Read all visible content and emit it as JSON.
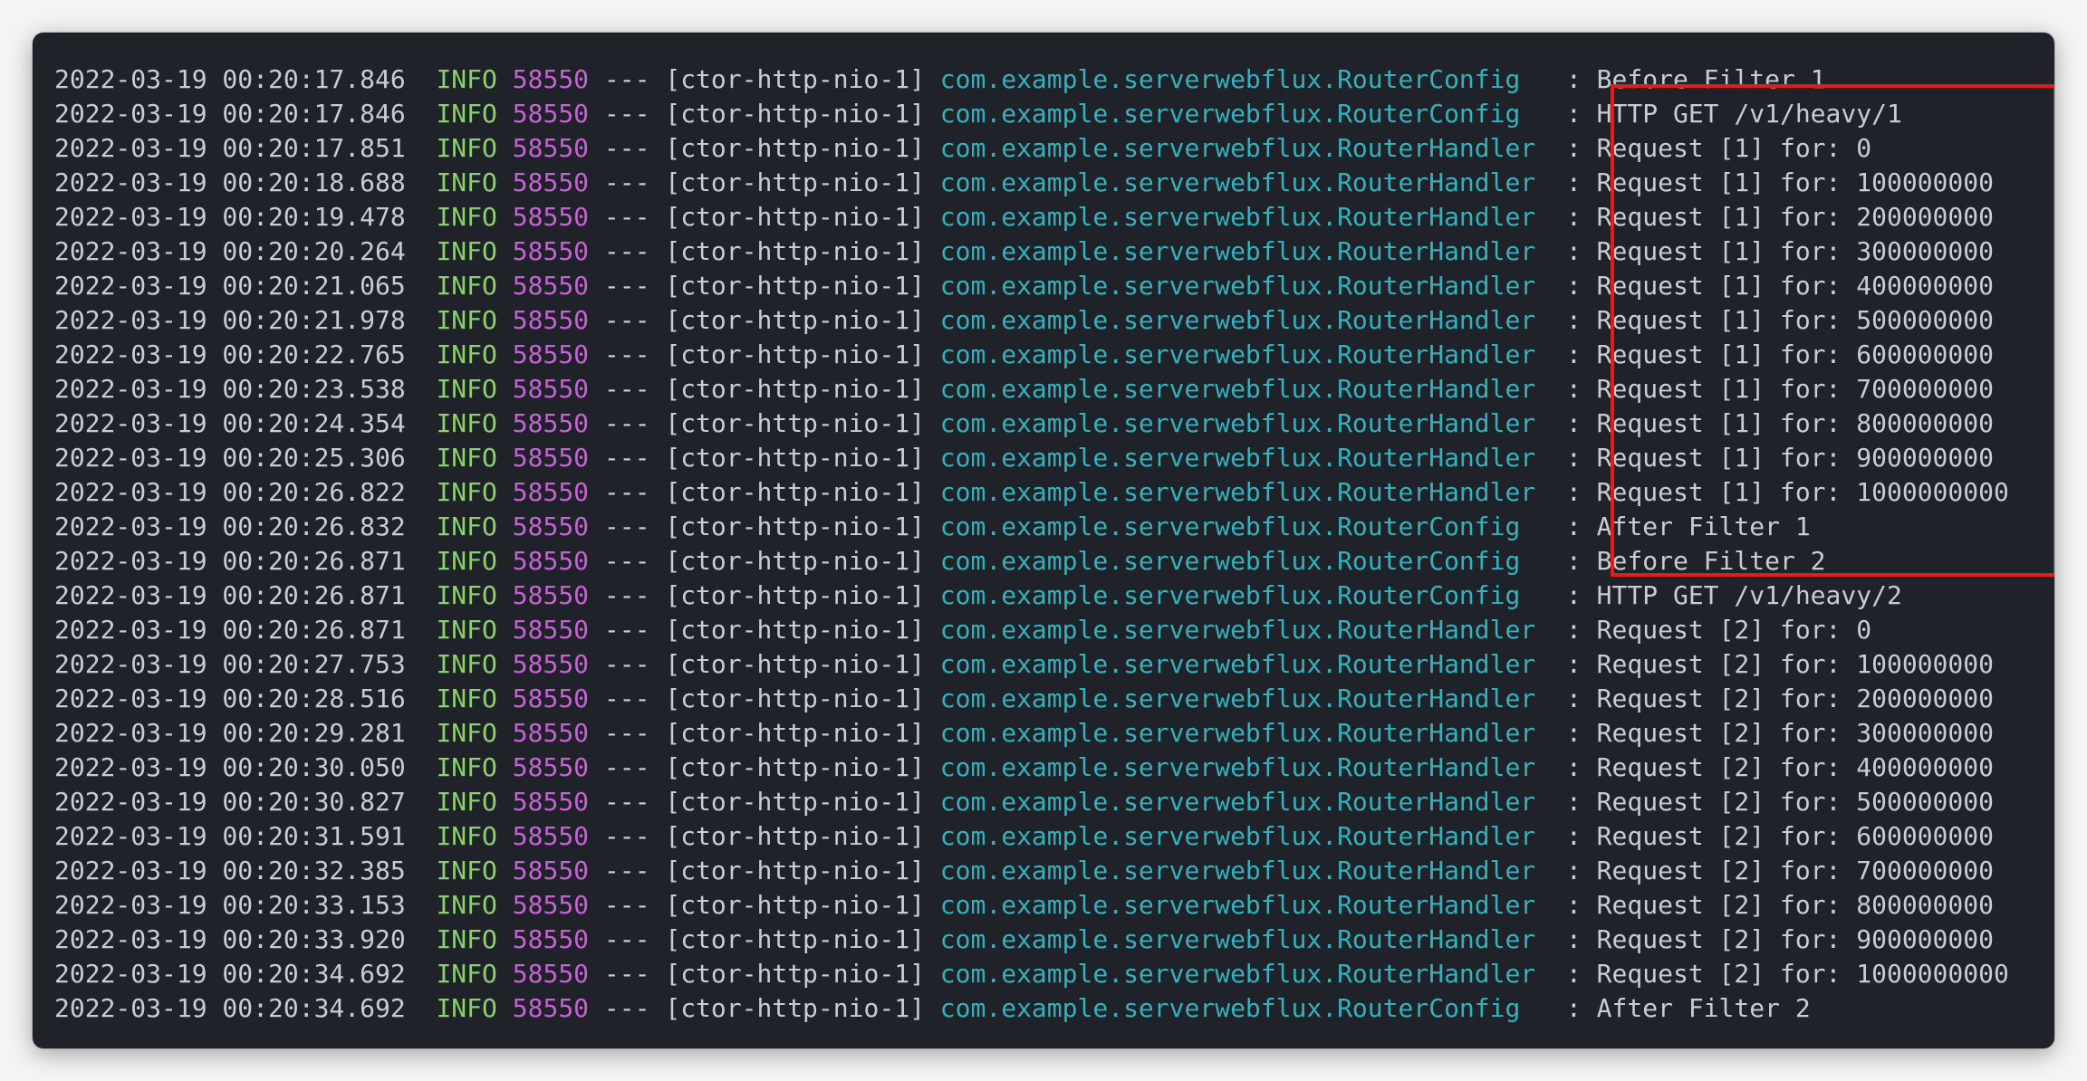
{
  "log": {
    "lines": [
      {
        "ts": "2022-03-19 00:20:17.846",
        "level": "INFO",
        "pid": "58550",
        "sep": "---",
        "thread": "[ctor-http-nio-1]",
        "cls": "com.example.serverwebflux.RouterConfig ",
        "msg": ": Before Filter 1"
      },
      {
        "ts": "2022-03-19 00:20:17.846",
        "level": "INFO",
        "pid": "58550",
        "sep": "---",
        "thread": "[ctor-http-nio-1]",
        "cls": "com.example.serverwebflux.RouterConfig ",
        "msg": ": HTTP GET /v1/heavy/1"
      },
      {
        "ts": "2022-03-19 00:20:17.851",
        "level": "INFO",
        "pid": "58550",
        "sep": "---",
        "thread": "[ctor-http-nio-1]",
        "cls": "com.example.serverwebflux.RouterHandler",
        "msg": ": Request [1] for: 0"
      },
      {
        "ts": "2022-03-19 00:20:18.688",
        "level": "INFO",
        "pid": "58550",
        "sep": "---",
        "thread": "[ctor-http-nio-1]",
        "cls": "com.example.serverwebflux.RouterHandler",
        "msg": ": Request [1] for: 100000000"
      },
      {
        "ts": "2022-03-19 00:20:19.478",
        "level": "INFO",
        "pid": "58550",
        "sep": "---",
        "thread": "[ctor-http-nio-1]",
        "cls": "com.example.serverwebflux.RouterHandler",
        "msg": ": Request [1] for: 200000000"
      },
      {
        "ts": "2022-03-19 00:20:20.264",
        "level": "INFO",
        "pid": "58550",
        "sep": "---",
        "thread": "[ctor-http-nio-1]",
        "cls": "com.example.serverwebflux.RouterHandler",
        "msg": ": Request [1] for: 300000000"
      },
      {
        "ts": "2022-03-19 00:20:21.065",
        "level": "INFO",
        "pid": "58550",
        "sep": "---",
        "thread": "[ctor-http-nio-1]",
        "cls": "com.example.serverwebflux.RouterHandler",
        "msg": ": Request [1] for: 400000000"
      },
      {
        "ts": "2022-03-19 00:20:21.978",
        "level": "INFO",
        "pid": "58550",
        "sep": "---",
        "thread": "[ctor-http-nio-1]",
        "cls": "com.example.serverwebflux.RouterHandler",
        "msg": ": Request [1] for: 500000000"
      },
      {
        "ts": "2022-03-19 00:20:22.765",
        "level": "INFO",
        "pid": "58550",
        "sep": "---",
        "thread": "[ctor-http-nio-1]",
        "cls": "com.example.serverwebflux.RouterHandler",
        "msg": ": Request [1] for: 600000000"
      },
      {
        "ts": "2022-03-19 00:20:23.538",
        "level": "INFO",
        "pid": "58550",
        "sep": "---",
        "thread": "[ctor-http-nio-1]",
        "cls": "com.example.serverwebflux.RouterHandler",
        "msg": ": Request [1] for: 700000000"
      },
      {
        "ts": "2022-03-19 00:20:24.354",
        "level": "INFO",
        "pid": "58550",
        "sep": "---",
        "thread": "[ctor-http-nio-1]",
        "cls": "com.example.serverwebflux.RouterHandler",
        "msg": ": Request [1] for: 800000000"
      },
      {
        "ts": "2022-03-19 00:20:25.306",
        "level": "INFO",
        "pid": "58550",
        "sep": "---",
        "thread": "[ctor-http-nio-1]",
        "cls": "com.example.serverwebflux.RouterHandler",
        "msg": ": Request [1] for: 900000000"
      },
      {
        "ts": "2022-03-19 00:20:26.822",
        "level": "INFO",
        "pid": "58550",
        "sep": "---",
        "thread": "[ctor-http-nio-1]",
        "cls": "com.example.serverwebflux.RouterHandler",
        "msg": ": Request [1] for: 1000000000"
      },
      {
        "ts": "2022-03-19 00:20:26.832",
        "level": "INFO",
        "pid": "58550",
        "sep": "---",
        "thread": "[ctor-http-nio-1]",
        "cls": "com.example.serverwebflux.RouterConfig ",
        "msg": ": After Filter 1"
      },
      {
        "ts": "2022-03-19 00:20:26.871",
        "level": "INFO",
        "pid": "58550",
        "sep": "---",
        "thread": "[ctor-http-nio-1]",
        "cls": "com.example.serverwebflux.RouterConfig ",
        "msg": ": Before Filter 2"
      },
      {
        "ts": "2022-03-19 00:20:26.871",
        "level": "INFO",
        "pid": "58550",
        "sep": "---",
        "thread": "[ctor-http-nio-1]",
        "cls": "com.example.serverwebflux.RouterConfig ",
        "msg": ": HTTP GET /v1/heavy/2"
      },
      {
        "ts": "2022-03-19 00:20:26.871",
        "level": "INFO",
        "pid": "58550",
        "sep": "---",
        "thread": "[ctor-http-nio-1]",
        "cls": "com.example.serverwebflux.RouterHandler",
        "msg": ": Request [2] for: 0"
      },
      {
        "ts": "2022-03-19 00:20:27.753",
        "level": "INFO",
        "pid": "58550",
        "sep": "---",
        "thread": "[ctor-http-nio-1]",
        "cls": "com.example.serverwebflux.RouterHandler",
        "msg": ": Request [2] for: 100000000"
      },
      {
        "ts": "2022-03-19 00:20:28.516",
        "level": "INFO",
        "pid": "58550",
        "sep": "---",
        "thread": "[ctor-http-nio-1]",
        "cls": "com.example.serverwebflux.RouterHandler",
        "msg": ": Request [2] for: 200000000"
      },
      {
        "ts": "2022-03-19 00:20:29.281",
        "level": "INFO",
        "pid": "58550",
        "sep": "---",
        "thread": "[ctor-http-nio-1]",
        "cls": "com.example.serverwebflux.RouterHandler",
        "msg": ": Request [2] for: 300000000"
      },
      {
        "ts": "2022-03-19 00:20:30.050",
        "level": "INFO",
        "pid": "58550",
        "sep": "---",
        "thread": "[ctor-http-nio-1]",
        "cls": "com.example.serverwebflux.RouterHandler",
        "msg": ": Request [2] for: 400000000"
      },
      {
        "ts": "2022-03-19 00:20:30.827",
        "level": "INFO",
        "pid": "58550",
        "sep": "---",
        "thread": "[ctor-http-nio-1]",
        "cls": "com.example.serverwebflux.RouterHandler",
        "msg": ": Request [2] for: 500000000"
      },
      {
        "ts": "2022-03-19 00:20:31.591",
        "level": "INFO",
        "pid": "58550",
        "sep": "---",
        "thread": "[ctor-http-nio-1]",
        "cls": "com.example.serverwebflux.RouterHandler",
        "msg": ": Request [2] for: 600000000"
      },
      {
        "ts": "2022-03-19 00:20:32.385",
        "level": "INFO",
        "pid": "58550",
        "sep": "---",
        "thread": "[ctor-http-nio-1]",
        "cls": "com.example.serverwebflux.RouterHandler",
        "msg": ": Request [2] for: 700000000"
      },
      {
        "ts": "2022-03-19 00:20:33.153",
        "level": "INFO",
        "pid": "58550",
        "sep": "---",
        "thread": "[ctor-http-nio-1]",
        "cls": "com.example.serverwebflux.RouterHandler",
        "msg": ": Request [2] for: 800000000"
      },
      {
        "ts": "2022-03-19 00:20:33.920",
        "level": "INFO",
        "pid": "58550",
        "sep": "---",
        "thread": "[ctor-http-nio-1]",
        "cls": "com.example.serverwebflux.RouterHandler",
        "msg": ": Request [2] for: 900000000"
      },
      {
        "ts": "2022-03-19 00:20:34.692",
        "level": "INFO",
        "pid": "58550",
        "sep": "---",
        "thread": "[ctor-http-nio-1]",
        "cls": "com.example.serverwebflux.RouterHandler",
        "msg": ": Request [2] for: 1000000000"
      },
      {
        "ts": "2022-03-19 00:20:34.692",
        "level": "INFO",
        "pid": "58550",
        "sep": "---",
        "thread": "[ctor-http-nio-1]",
        "cls": "com.example.serverwebflux.RouterConfig ",
        "msg": ": After Filter 2"
      }
    ]
  },
  "colors": {
    "background": "#1f2229",
    "text": "#c8ccd4",
    "level": "#8ccf6e",
    "pid": "#c861d6",
    "logger": "#33b2bd",
    "highlight_border": "#e41b1b"
  }
}
